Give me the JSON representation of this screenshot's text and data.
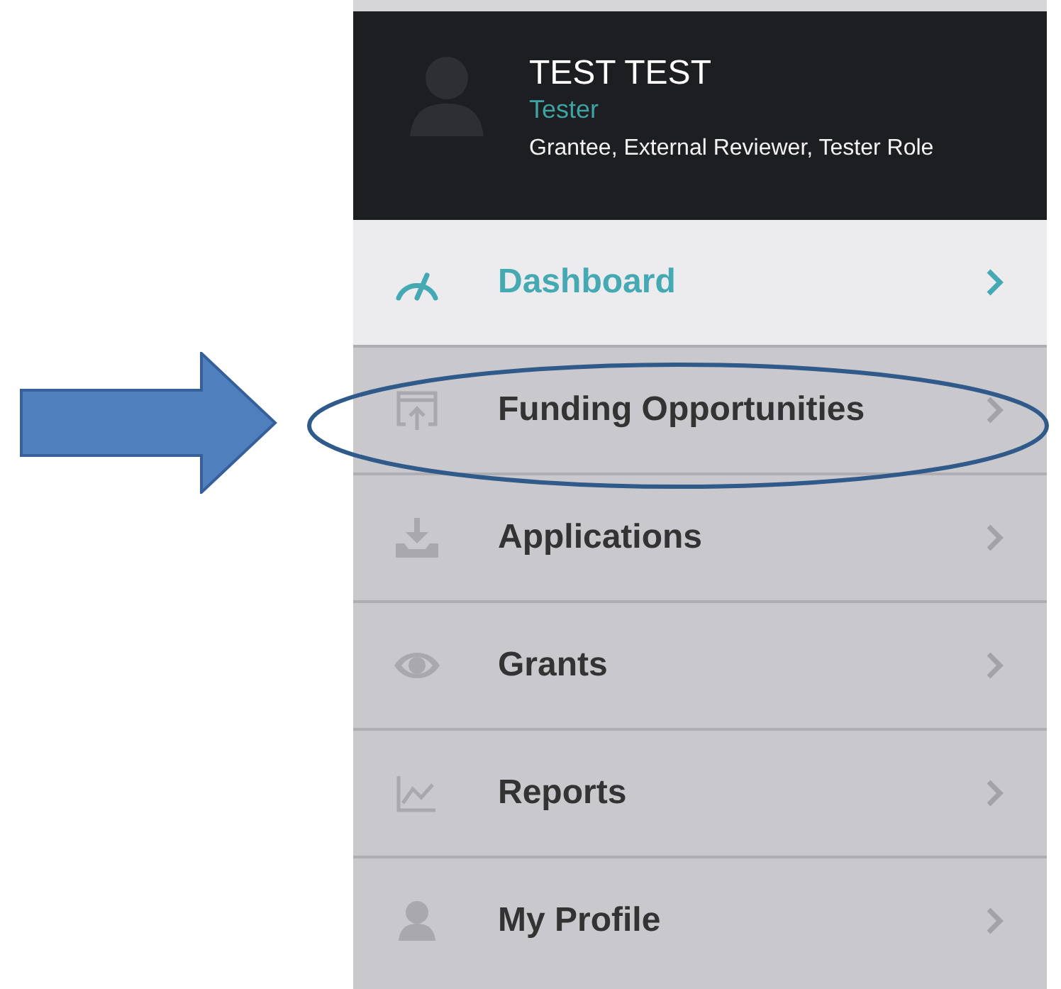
{
  "user": {
    "name": "TEST TEST",
    "title": "Tester",
    "roles": "Grantee, External Reviewer, Tester Role"
  },
  "menu": [
    {
      "label": "Dashboard",
      "selected": true
    },
    {
      "label": "Funding Opportunities",
      "selected": false
    },
    {
      "label": "Applications",
      "selected": false
    },
    {
      "label": "Grants",
      "selected": false
    },
    {
      "label": "Reports",
      "selected": false
    },
    {
      "label": "My Profile",
      "selected": false
    }
  ]
}
